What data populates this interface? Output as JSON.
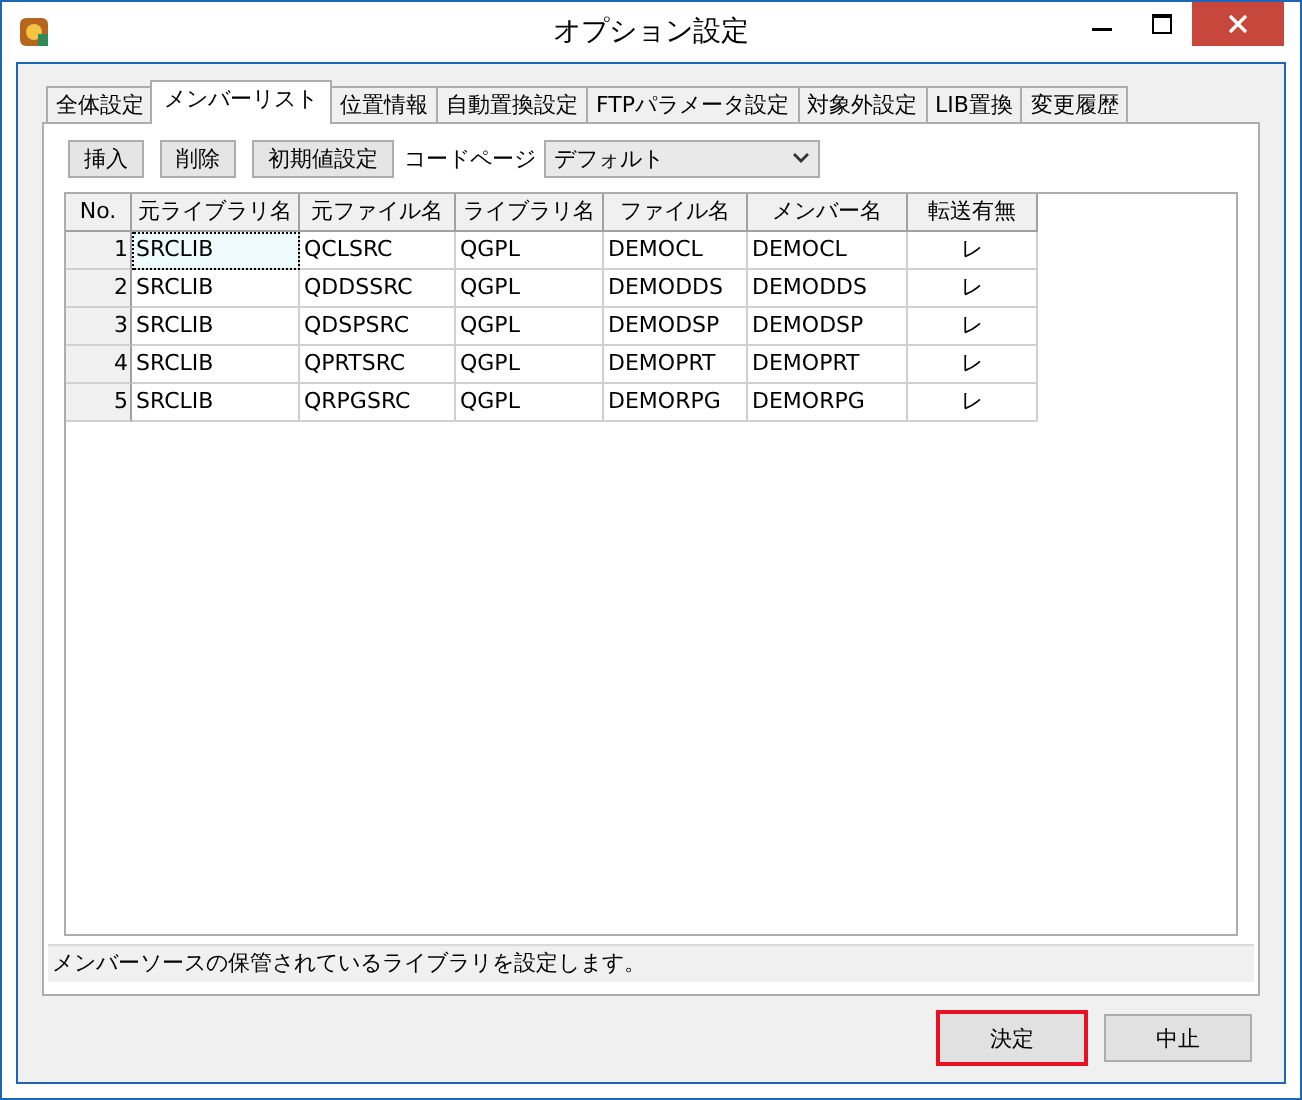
{
  "window": {
    "title": "オプション設定"
  },
  "tabs": [
    {
      "label": "全体設定",
      "selected": false
    },
    {
      "label": "メンバーリスト",
      "selected": true
    },
    {
      "label": "位置情報",
      "selected": false
    },
    {
      "label": "自動置換設定",
      "selected": false
    },
    {
      "label": "FTPパラメータ設定",
      "selected": false
    },
    {
      "label": "対象外設定",
      "selected": false
    },
    {
      "label": "LIB置換",
      "selected": false
    },
    {
      "label": "変更履歴",
      "selected": false
    }
  ],
  "toolbar": {
    "buttons": [
      "挿入",
      "削除",
      "初期値設定"
    ],
    "code_page_label": "コードページ",
    "code_page_value": "デフォルト"
  },
  "table": {
    "columns": [
      "No.",
      "元ライブラリ名",
      "元ファイル名",
      "ライブラリ名",
      "ファイル名",
      "メンバー名",
      "転送有無"
    ],
    "rows": [
      {
        "selected": true,
        "cells": [
          "1",
          "SRCLIB",
          "QCLSRC",
          "QGPL",
          "DEMOCL",
          "DEMOCL",
          "レ"
        ]
      },
      {
        "selected": false,
        "cells": [
          "2",
          "SRCLIB",
          "QDDSSRC",
          "QGPL",
          "DEMODDS",
          "DEMODDS",
          "レ"
        ]
      },
      {
        "selected": false,
        "cells": [
          "3",
          "SRCLIB",
          "QDSPSRC",
          "QGPL",
          "DEMODSP",
          "DEMODSP",
          "レ"
        ]
      },
      {
        "selected": false,
        "cells": [
          "4",
          "SRCLIB",
          "QPRTSRC",
          "QGPL",
          "DEMOPRT",
          "DEMOPRT",
          "レ"
        ]
      },
      {
        "selected": false,
        "cells": [
          "5",
          "SRCLIB",
          "QRPGSRC",
          "QGPL",
          "DEMORPG",
          "DEMORPG",
          "レ"
        ]
      }
    ]
  },
  "status_bar": "メンバーソースの保管されているライブラリを設定します。",
  "buttons": [
    {
      "label": "決定",
      "highlighted": true
    },
    {
      "label": "中止",
      "highlighted": false
    }
  ]
}
